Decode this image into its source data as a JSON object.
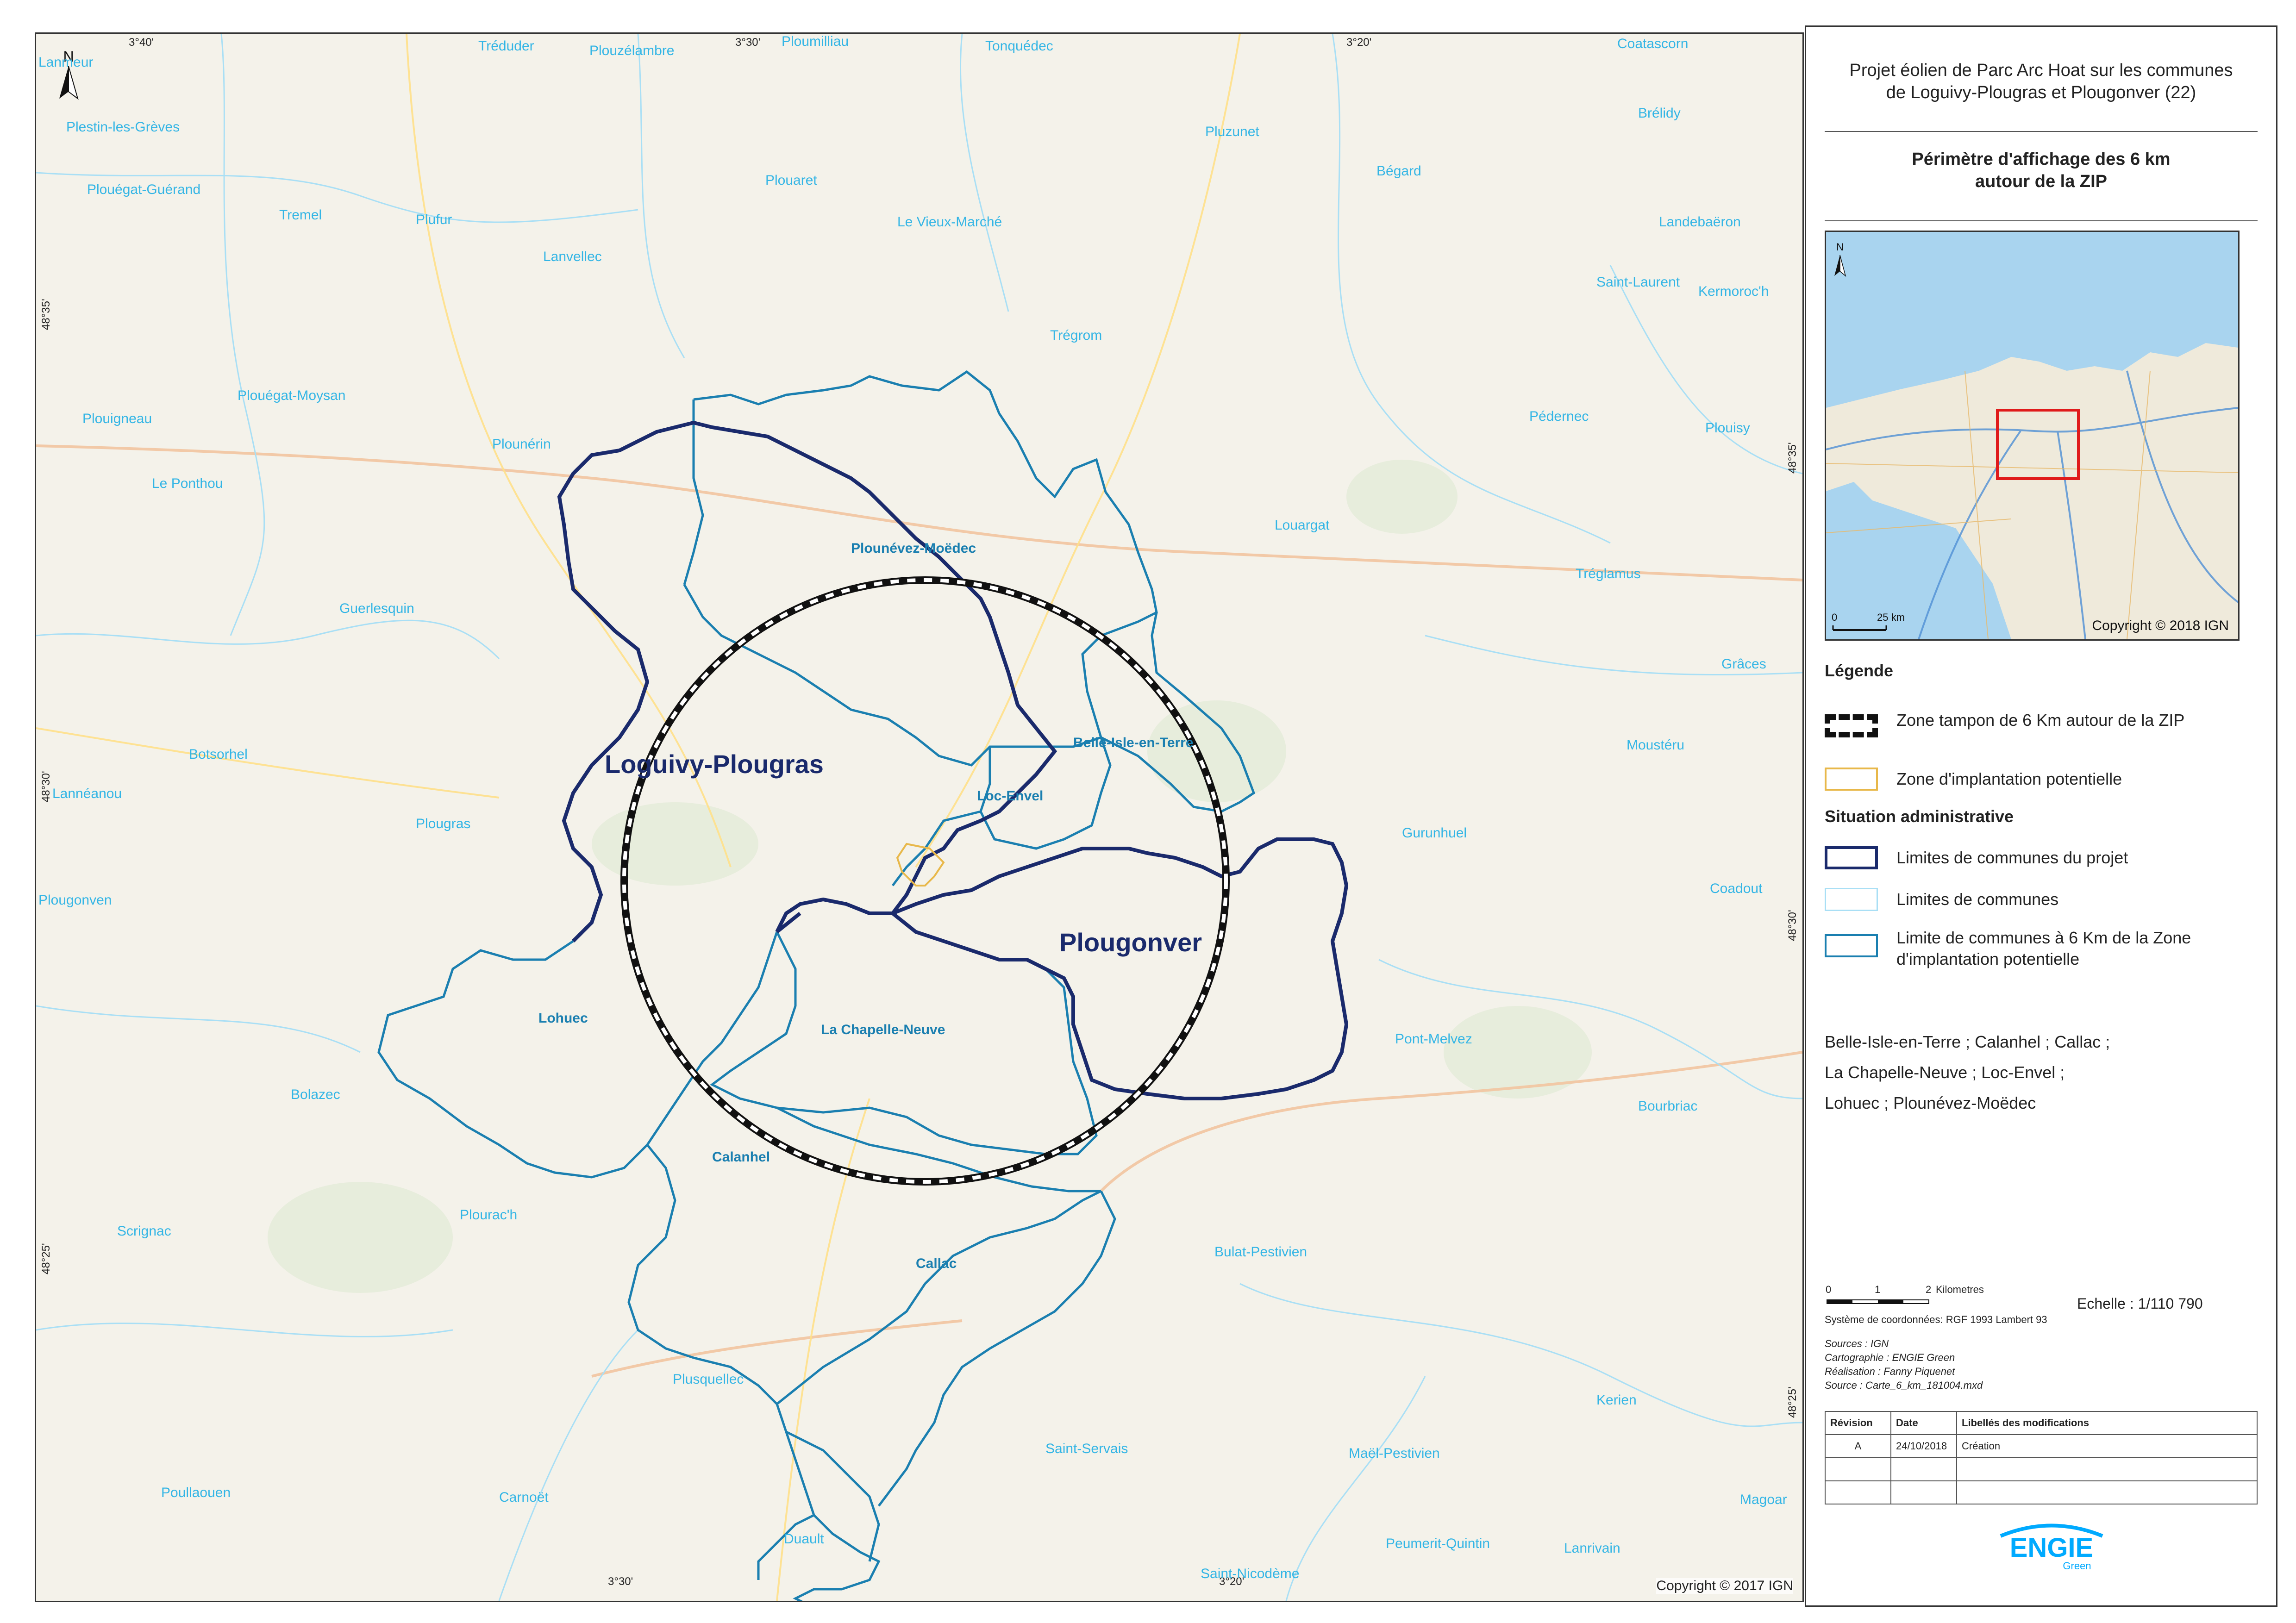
{
  "map": {
    "copyright": "Copyright © 2017 IGN",
    "north_label": "N",
    "coords": {
      "top": [
        "3°40'",
        "3°30'",
        "3°20'"
      ],
      "bottom": [
        "3°30'",
        "3°20'"
      ],
      "left": [
        "48°35'",
        "48°30'",
        "48°25'"
      ],
      "right": [
        "48°35'",
        "48°30'",
        "48°25'"
      ]
    },
    "project_communes": [
      "Loguivy-Plougras",
      "Plougonver"
    ],
    "buffer_communes": [
      "Plounévez-Moëdec",
      "Belle-Isle-en-Terre",
      "Loc-Envel",
      "La Chapelle-Neuve",
      "Lohuec",
      "Calanhel",
      "Callac"
    ],
    "places": [
      "Lanmeur",
      "Plestin-les-Grèves",
      "Tréduder",
      "Plouzélambre",
      "Ploumilliau",
      "Tonquédec",
      "Coatascorn",
      "Brélidy",
      "Plouégat-Guérand",
      "Pluzunet",
      "Bégard",
      "Tremel",
      "Plufur",
      "Plouaret",
      "Le Vieux-Marché",
      "Lanvellec",
      "Landebaëron",
      "Saint-Laurent",
      "Kermoroc'h",
      "Trégrom",
      "Plouégat-Moysan",
      "Plouigneau",
      "Plounérin",
      "Pédernec",
      "Plouisy",
      "Le Ponthou",
      "Louargat",
      "Tréglamus",
      "Guerlesquin",
      "Grâces",
      "Botsorhel",
      "Moustéru",
      "Lannéanou",
      "Plougras",
      "Gurunhuel",
      "Coadout",
      "Plougonven",
      "Pont-Melvez",
      "Bolazec",
      "Bourbriac",
      "Scrignac",
      "Plourac'h",
      "Bulat-Pestivien",
      "Plusquellec",
      "Kerien",
      "Saint-Servais",
      "Maël-Pestivien",
      "Poullaouen",
      "Carnoët",
      "Magoar",
      "Duault",
      "Peumerit-Quintin",
      "Lanrivain",
      "Saint-Nicodème"
    ]
  },
  "panel": {
    "title_line1": "Projet éolien de Parc Arc Hoat sur les communes",
    "title_line2": "de Loguivy-Plougras et Plougonver (22)",
    "subtitle_line1": "Périmètre d'affichage des 6 km",
    "subtitle_line2": "autour de la ZIP",
    "inset": {
      "north_label": "N",
      "scale_zero": "0",
      "scale_25": "25 km",
      "copyright": "Copyright © 2018 IGN"
    },
    "legend": {
      "heading": "Légende",
      "buffer": "Zone tampon de 6 Km autour de la ZIP",
      "zip": "Zone d'implantation potentielle",
      "admin_heading": "Situation administrative",
      "project_limits": "Limites de communes du projet",
      "commune_limits": "Limites de communes",
      "six_km_limits": "Limite de communes à 6 Km de la Zone d'implantation potentielle"
    },
    "communes_list": [
      "Belle-Isle-en-Terre ; Calanhel ; Callac ;",
      "La Chapelle-Neuve ; Loc-Envel ;",
      "Lohuec ; Plounévez-Moëdec"
    ],
    "scale": {
      "ticks": [
        "0",
        "1",
        "2"
      ],
      "unit": "Kilometres",
      "ratio": "Echelle : 1/110 790",
      "crs": "Système de coordonnées: RGF 1993 Lambert 93"
    },
    "sources": [
      "Sources : IGN",
      "Cartographie : ENGIE Green",
      "Réalisation : Fanny Piquenet",
      "Source : Carte_6_km_181004.mxd"
    ],
    "revisions": {
      "headers": [
        "Révision",
        "Date",
        "Libellés des modifications"
      ],
      "rows": [
        [
          "A",
          "24/10/2018",
          "Création"
        ],
        [
          "",
          "",
          ""
        ],
        [
          "",
          "",
          ""
        ]
      ]
    },
    "logo": {
      "main": "ENGIE",
      "sub": "Green"
    },
    "colors": {
      "project": "#1a2a6c",
      "six_km": "#1a7fb0",
      "communes": "#a9dff5",
      "zip": "#e8b84a",
      "inset_rect": "#e01b1b"
    }
  }
}
